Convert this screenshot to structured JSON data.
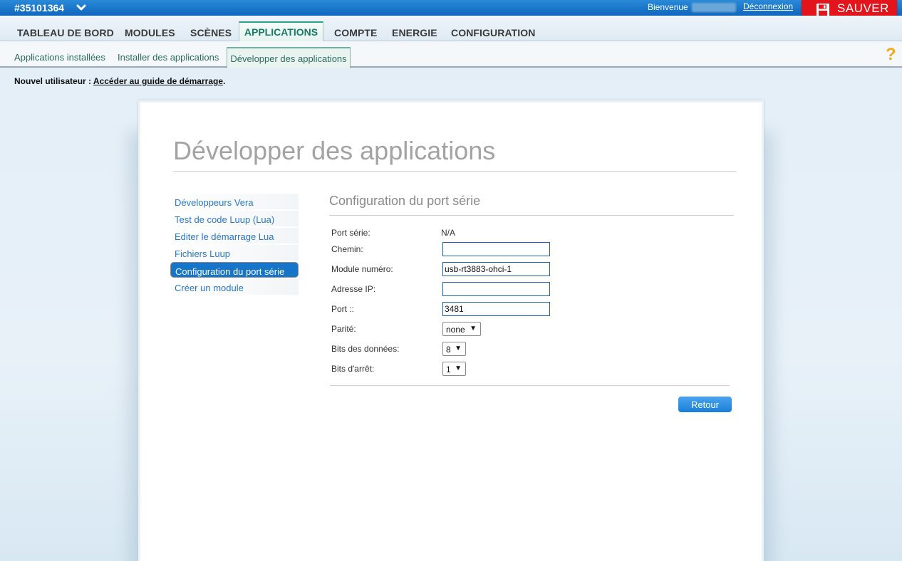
{
  "header": {
    "device_id": "#35101364",
    "welcome": "Bienvenue",
    "logout": "Déconnexion",
    "save": "SAUVER",
    "icons": {
      "device_menu": "chevron-down-icon",
      "save": "floppy-disk-icon"
    },
    "colors": {
      "bar": "#1a76c9",
      "save": "#e3141b"
    }
  },
  "main_nav": {
    "items": [
      "TABLEAU DE BORD",
      "MODULES",
      "SCÈNES",
      "APPLICATIONS",
      "COMPTE",
      "ENERGIE",
      "CONFIGURATION"
    ],
    "active": "APPLICATIONS"
  },
  "sub_nav": {
    "items": [
      "Applications installées",
      "Installer des applications",
      "Développer des applications"
    ],
    "active": "Développer des applications",
    "help_icon": "?"
  },
  "new_user": {
    "prefix": "Nouvel utilisateur :",
    "link": "Accéder au guide de démarrage",
    "suffix": "."
  },
  "page": {
    "title": "Développer des applications",
    "side_menu": [
      "Développeurs Vera",
      "Test de code Luup (Lua)",
      "Editer le démarrage Lua",
      "Fichiers Luup",
      "Configuration du port série",
      "Créer un module"
    ],
    "side_menu_selected": "Configuration du port série"
  },
  "serial_config": {
    "title": "Configuration du port série",
    "port_serie_label": "Port série:",
    "port_serie_value": "N/A",
    "chemin_label": "Chemin:",
    "chemin_value": "",
    "module_label": "Module numéro:",
    "module_value": "usb-rt3883-ohci-1",
    "ip_label": "Adresse IP:",
    "ip_value": "",
    "port_label": "Port ::",
    "port_value": "3481",
    "parite_label": "Parité:",
    "parite_value": "none",
    "bits_donnees_label": "Bits des données:",
    "bits_donnees_value": "8",
    "bits_arret_label": "Bits d'arrêt:",
    "bits_arret_value": "1",
    "back_button": "Retour"
  }
}
